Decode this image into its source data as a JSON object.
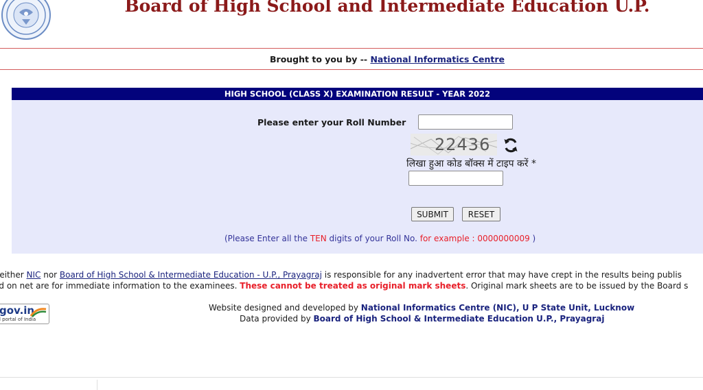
{
  "header": {
    "title": "Board of High School and Intermediate Education U.P.",
    "logo_icon": "up-government-emblem-icon"
  },
  "credit": {
    "prefix": "Brought to you by -- ",
    "link": "National Informatics Centre"
  },
  "form": {
    "panel_title": "HIGH SCHOOL (CLASS X)  EXAMINATION RESULT - YEAR 2022",
    "roll_label": "Please enter your Roll Number",
    "roll_value": "",
    "captcha_code": "22436",
    "captcha_label": "लिखा हुआ कोड बॉक्स में टाइप करें *",
    "captcha_value": "",
    "submit_label": "SUBMIT",
    "reset_label": "RESET",
    "hint_open": "(Please Enter all the ",
    "hint_ten": "TEN",
    "hint_mid": " digits of your Roll No. ",
    "hint_example": "for example : 0000000009",
    "hint_close": " )"
  },
  "disclaimer": {
    "line1_part1": "leither ",
    "line1_link1": "NIC",
    "line1_part2": " nor ",
    "line1_link2": "Board of High School & Intermediate Education - U.P., Prayagraj",
    "line1_part3": " is responsible for any inadvertent error that may have crept in the results being publis",
    "line2_part1": "ed on net are for immediate information to the examinees. ",
    "line2_red": "These cannot be treated as original mark sheets",
    "line2_part2": ". Original mark sheets are to be issued by the Board s"
  },
  "govin": {
    "text": "gov.in",
    "sub": "l portal of India"
  },
  "footer": {
    "line1_prefix": "Website designed and developed by ",
    "line1_bold": "National Informatics Centre (NIC), U P State Unit, Lucknow",
    "line2_prefix": "Data provided by ",
    "line2_bold": "Board of High School & Intermediate Education U.P., Prayagraj"
  },
  "colors": {
    "title": "#8b1a1a",
    "panel_header": "#03037c",
    "panel_bg": "#e7e9fb",
    "accent_red": "#e8202a",
    "link_navy": "#1a237e"
  }
}
